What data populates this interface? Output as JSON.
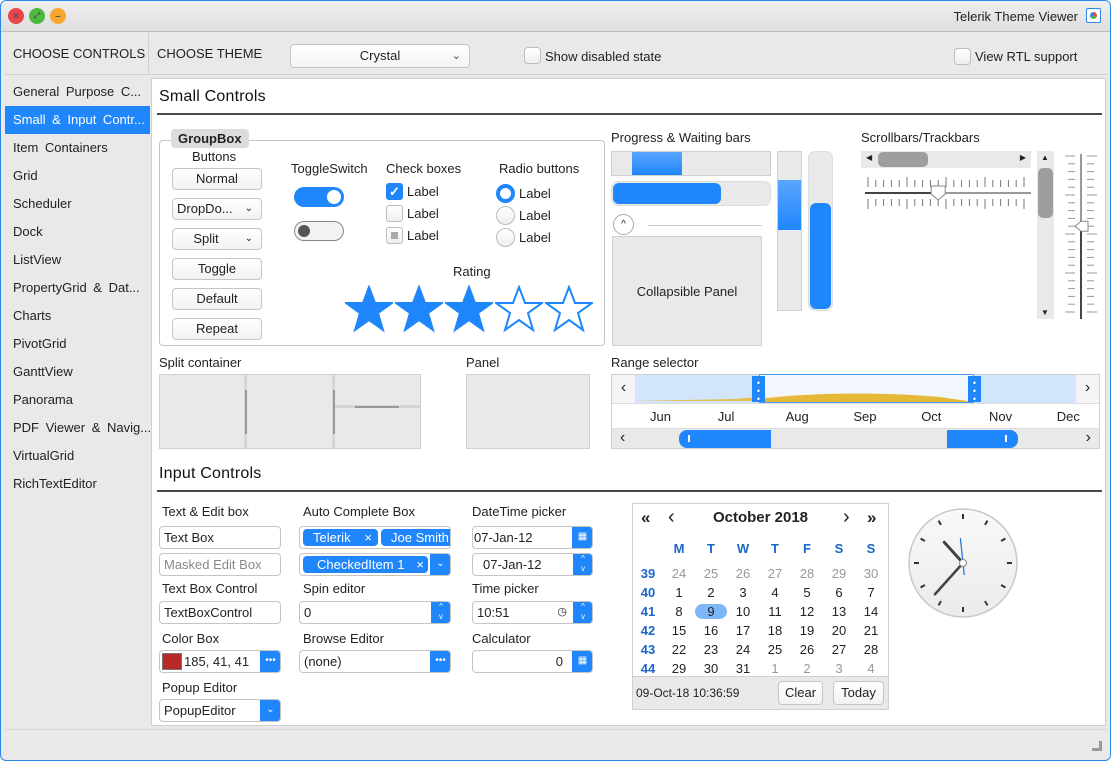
{
  "window": {
    "title": "Telerik Theme Viewer"
  },
  "topbar": {
    "choose_controls": "CHOOSE CONTROLS",
    "choose_theme": "CHOOSE THEME",
    "theme_value": "Crystal",
    "show_disabled": "Show disabled state",
    "show_disabled_checked": false,
    "rtl": "View RTL support",
    "rtl_checked": false
  },
  "sidebar": {
    "selected_index": 1,
    "items": [
      {
        "label": "General Purpose C..."
      },
      {
        "label": "Small & Input Contr..."
      },
      {
        "label": "Item Containers"
      },
      {
        "label": "Grid"
      },
      {
        "label": "Scheduler"
      },
      {
        "label": "Dock"
      },
      {
        "label": "ListView"
      },
      {
        "label": "PropertyGrid & Dat..."
      },
      {
        "label": "Charts"
      },
      {
        "label": "PivotGrid"
      },
      {
        "label": "GanttView"
      },
      {
        "label": "Panorama"
      },
      {
        "label": "PDF Viewer & Navig..."
      },
      {
        "label": "VirtualGrid"
      },
      {
        "label": "RichTextEditor"
      }
    ]
  },
  "small_controls": {
    "title": "Small Controls",
    "groupbox": {
      "title": "GroupBox",
      "buttons_label": "Buttons",
      "buttons": [
        "Normal",
        "DropDo...",
        "Split",
        "Toggle",
        "Default",
        "Repeat"
      ],
      "toggle_label": "ToggleSwitch",
      "toggles": [
        true,
        false
      ],
      "checkbox_label": "Check boxes",
      "checkboxes": [
        {
          "label": "Label",
          "state": "checked"
        },
        {
          "label": "Label",
          "state": "unchecked"
        },
        {
          "label": "Label",
          "state": "indeterminate"
        }
      ],
      "radio_label": "Radio buttons",
      "radios": [
        {
          "label": "Label",
          "selected": true
        },
        {
          "label": "Label",
          "selected": false
        },
        {
          "label": "Label",
          "selected": false
        }
      ],
      "rating_label": "Rating",
      "rating_value": 3,
      "rating_max": 5
    },
    "progress": {
      "label": "Progress & Waiting bars",
      "waiting_h_position": 0.12,
      "progress_h": 0.69,
      "waiting_v_position": 0.15,
      "progress_v": 0.68,
      "collapsible_panel": "Collapsible Panel"
    },
    "scroll": {
      "label": "Scrollbars/Trackbars",
      "h_scroll_value": 0.05,
      "h_track_value": 0.45,
      "v_scroll_value": 0.05,
      "v_track_value": 0.45
    },
    "split_label": "Split container",
    "panel_label": "Panel",
    "range": {
      "label": "Range selector",
      "months": [
        "Jun",
        "Jul",
        "Aug",
        "Sep",
        "Oct",
        "Nov",
        "Dec"
      ],
      "start": "Jul",
      "end": "Nov"
    }
  },
  "input_controls": {
    "title": "Input Controls",
    "text_edit_label": "Text & Edit box",
    "text_box": "Text Box",
    "masked_placeholder": "Masked Edit Box",
    "text_box_control_label": "Text Box Control",
    "text_box_control": "TextBoxControl",
    "color_box_label": "Color Box",
    "color_value": "185, 41, 41",
    "color_swatch": "#b92929",
    "popup_label": "Popup Editor",
    "popup_value": "PopupEditor",
    "autocomplete_label": "Auto Complete Box",
    "tokens": [
      "Telerik",
      "Joe Smith"
    ],
    "checked_token": "CheckedItem 1",
    "spin_label": "Spin editor",
    "spin_value": "0",
    "browse_label": "Browse Editor",
    "browse_value": "(none)",
    "datetime_label": "DateTime picker",
    "date1": "07-Jan-12",
    "date2": "07-Jan-12",
    "time_label": "Time picker",
    "time_value": "10:51",
    "calc_label": "Calculator",
    "calc_value": "0",
    "calendar": {
      "title": "October 2018",
      "nav": {
        "first": "«",
        "prev": "‹",
        "next": "›",
        "last": "»"
      },
      "day_headers": [
        "M",
        "T",
        "W",
        "T",
        "F",
        "S",
        "S"
      ],
      "weeks": [
        {
          "wk": "39",
          "days": [
            "24",
            "25",
            "26",
            "27",
            "28",
            "29",
            "30"
          ],
          "other": [
            1,
            1,
            1,
            1,
            1,
            1,
            1
          ]
        },
        {
          "wk": "40",
          "days": [
            "1",
            "2",
            "3",
            "4",
            "5",
            "6",
            "7"
          ],
          "other": [
            0,
            0,
            0,
            0,
            0,
            0,
            0
          ]
        },
        {
          "wk": "41",
          "days": [
            "8",
            "9",
            "10",
            "11",
            "12",
            "13",
            "14"
          ],
          "other": [
            0,
            0,
            0,
            0,
            0,
            0,
            0
          ]
        },
        {
          "wk": "42",
          "days": [
            "15",
            "16",
            "17",
            "18",
            "19",
            "20",
            "21"
          ],
          "other": [
            0,
            0,
            0,
            0,
            0,
            0,
            0
          ]
        },
        {
          "wk": "43",
          "days": [
            "22",
            "23",
            "24",
            "25",
            "26",
            "27",
            "28"
          ],
          "other": [
            0,
            0,
            0,
            0,
            0,
            0,
            0
          ]
        },
        {
          "wk": "44",
          "days": [
            "29",
            "30",
            "31",
            "1",
            "2",
            "3",
            "4"
          ],
          "other": [
            0,
            0,
            0,
            1,
            1,
            1,
            1
          ]
        }
      ],
      "selected_day": "9",
      "footer_datetime": "09-Oct-18 10:36:59",
      "clear": "Clear",
      "today": "Today"
    },
    "clock": {
      "hours": 10,
      "minutes": 36,
      "seconds": 59
    }
  }
}
